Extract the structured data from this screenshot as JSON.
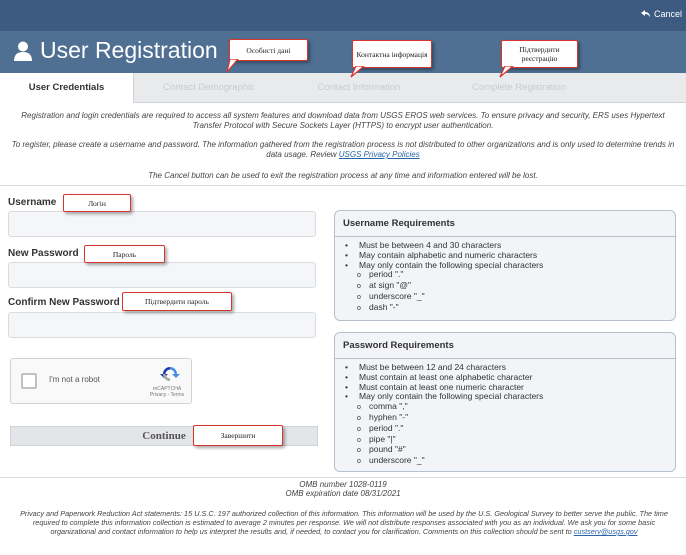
{
  "header": {
    "cancel_label": "Cancel",
    "title": "User Registration"
  },
  "tabs": [
    {
      "label": "User Credentials",
      "active": true
    },
    {
      "label": "Contact Demographic",
      "active": false
    },
    {
      "label": "Contact Information",
      "active": false
    },
    {
      "label": "Complete Registration",
      "active": false
    }
  ],
  "intro": {
    "p1": "Registration and login credentials are required to access all system features and download data from USGS EROS web services. To ensure privacy and security, ERS uses Hypertext Transfer Protocol with Secure Sockets Layer (HTTPS) to encrypt user authentication.",
    "p2": "To register, please create a username and password. The information gathered from the registration process is not distributed to other organizations and is only used to determine trends in data usage. Review",
    "p2_link": "USGS Privacy Policies",
    "p3": "The Cancel button can be used to exit the registration process at any time and information entered will be lost."
  },
  "form": {
    "username_label": "Username",
    "username_value": "",
    "new_password_label": "New Password",
    "new_password_value": "",
    "confirm_password_label": "Confirm New Password",
    "confirm_password_value": "",
    "captcha_text": "I'm not a robot",
    "captcha_brand": "reCAPTCHA",
    "captcha_terms": "Privacy - Terms",
    "continue_label": "Continue"
  },
  "username_requirements": {
    "title": "Username Requirements",
    "items": [
      {
        "text": "Must be between 4 and 30 characters",
        "level": "bullet"
      },
      {
        "text": "May contain alphabetic and numeric characters",
        "level": "bullet"
      },
      {
        "text": "May only contain the following special characters",
        "level": "bullet"
      },
      {
        "text": "period \".\"",
        "level": "sub"
      },
      {
        "text": "at sign \"@\"",
        "level": "sub"
      },
      {
        "text": "underscore \"_\"",
        "level": "sub"
      },
      {
        "text": "dash \"-\"",
        "level": "sub"
      }
    ]
  },
  "password_requirements": {
    "title": "Password Requirements",
    "items": [
      {
        "text": "Must be between 12 and 24 characters",
        "level": "bullet"
      },
      {
        "text": "Must contain at least one alphabetic character",
        "level": "bullet"
      },
      {
        "text": "Must contain at least one numeric character",
        "level": "bullet"
      },
      {
        "text": "May only contain the following special characters",
        "level": "bullet"
      },
      {
        "text": "comma \",\"",
        "level": "sub"
      },
      {
        "text": "hyphen \"-\"",
        "level": "sub"
      },
      {
        "text": "period \".\"",
        "level": "sub"
      },
      {
        "text": "pipe \"|\"",
        "level": "sub"
      },
      {
        "text": "pound \"#\"",
        "level": "sub"
      },
      {
        "text": "underscore \"_\"",
        "level": "sub"
      }
    ]
  },
  "callouts": {
    "personal_data": "Особисті дані",
    "contact_info": "Контактна інформація",
    "confirm_registration": "Підтвердити реєстрацію",
    "login": "Логін",
    "password": "Пароль",
    "confirm_password": "Підтвердити пароль",
    "finish": "Завершити"
  },
  "footer": {
    "omb_number": "OMB number 1028-0119",
    "omb_expiration": "OMB expiration date 08/31/2021",
    "privacy_text": "Privacy and Paperwork Reduction Act statements: 15 U.S.C. 197 authorized collection of this information. This information will be used by the U.S. Geological Survey to better serve the public. The time required to complete this information collection is estimated to average 2 minutes per response. We will not distribute responses associated with you as an individual. We ask you for some basic organizational and contact information to help us interpret the results and, if needed, to contact you for clarification. Comments on this collection should be sent to",
    "privacy_email": "custserv@usgs.gov"
  },
  "colors": {
    "topbar": "#3d5a80",
    "titlebar": "#4f6f93",
    "callout_border": "#d9352f",
    "link": "#2a64a8"
  }
}
